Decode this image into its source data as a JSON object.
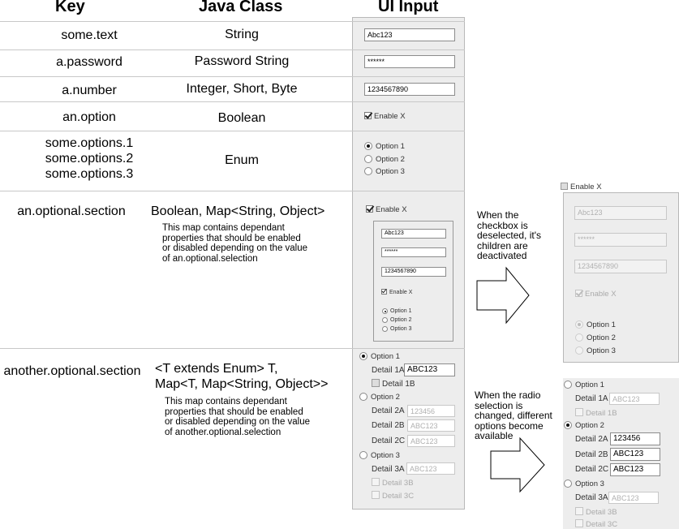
{
  "headers": {
    "key": "Key",
    "java_class": "Java Class",
    "ui_input": "UI Input"
  },
  "rows": {
    "text": {
      "key": "some.text",
      "cls": "String",
      "value": "Abc123"
    },
    "password": {
      "key": "a.password",
      "cls": "Password String",
      "value": "******"
    },
    "number": {
      "key": "a.number",
      "cls": "Integer, Short, Byte",
      "value": "1234567890"
    },
    "option": {
      "key": "an.option",
      "cls": "Boolean",
      "checkbox": "Enable X"
    },
    "options": {
      "key1": "some.options.1",
      "key2": "some.options.2",
      "key3": "some.options.3",
      "cls": "Enum",
      "opt1": "Option 1",
      "opt2": "Option 2",
      "opt3": "Option 3"
    },
    "optional": {
      "key": "an.optional.section",
      "cls": "Boolean, Map<String, Object>",
      "note": [
        "This map contains dependant",
        "properties that should be enabled",
        "or disabled depending on the value",
        "of an.optional.selection"
      ],
      "checkbox": "Enable X",
      "text": "Abc123",
      "password": "******",
      "number": "1234567890",
      "inner_checkbox": "Enable X",
      "opt1": "Option 1",
      "opt2": "Option 2",
      "opt3": "Option 3"
    },
    "another": {
      "key": "another.optional.section",
      "cls1": "<T extends Enum> T,",
      "cls2": "Map<T, Map<String, Object>>",
      "note": [
        "This map contains dependant",
        "properties that should be enabled",
        "or disabled depending on the value",
        "of another.optional.selection"
      ],
      "opt1": "Option 1",
      "d1a_label": "Detail 1A",
      "d1a_value": "ABC123",
      "d1b": "Detail 1B",
      "opt2": "Option 2",
      "d2a_label": "Detail 2A",
      "d2a_value": "123456",
      "d2b_label": "Detail 2B",
      "d2b_value": "ABC123",
      "d2c_label": "Detail 2C",
      "d2c_value": "ABC123",
      "opt3": "Option 3",
      "d3a_label": "Detail 3A",
      "d3a_value": "ABC123",
      "d3b": "Detail 3B",
      "d3c": "Detail 3C"
    }
  },
  "explanations": {
    "checkbox": [
      "When the",
      "checkbox is",
      "deselected, it's",
      "children are",
      "deactivated"
    ],
    "radio": [
      "When the radio",
      "selection is",
      "changed, different",
      "options become",
      "available"
    ]
  },
  "deselected": {
    "checkbox": "Enable X",
    "text": "Abc123",
    "password": "******",
    "number": "1234567890",
    "inner_checkbox": "Enable X",
    "opt1": "Option 1",
    "opt2": "Option 2",
    "opt3": "Option 3"
  },
  "changed": {
    "opt1": "Option 1",
    "d1a_label": "Detail 1A",
    "d1a_value": "ABC123",
    "d1b": "Detail 1B",
    "opt2": "Option 2",
    "d2a_label": "Detail 2A",
    "d2a_value": "123456",
    "d2b_label": "Detail 2B",
    "d2b_value": "ABC123",
    "d2c_label": "Detail 2C",
    "d2c_value": "ABC123",
    "opt3": "Option 3",
    "d3a_label": "Detail 3A",
    "d3a_value": "ABC123",
    "d3b": "Detail 3B",
    "d3c": "Detail 3C"
  }
}
